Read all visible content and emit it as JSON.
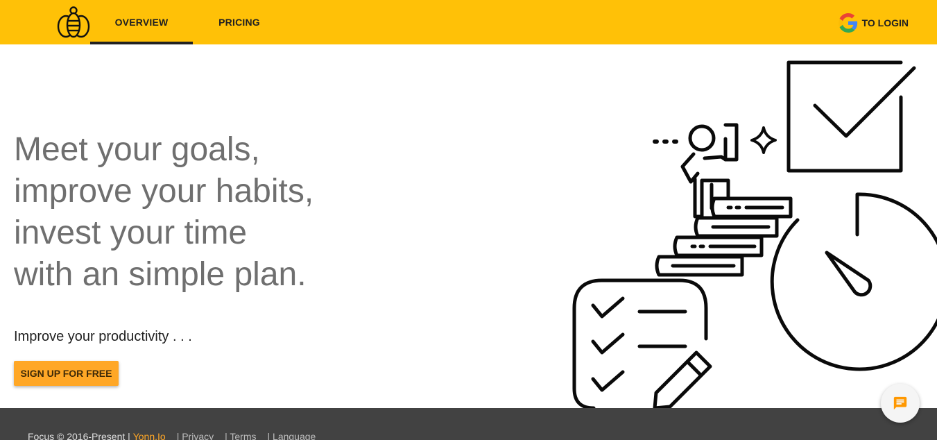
{
  "header": {
    "tabs": [
      {
        "label": "OVERVIEW",
        "active": true
      },
      {
        "label": "PRICING",
        "active": false
      }
    ],
    "login_label": "TO LOGIN",
    "login_icon": "google-icon",
    "logo_icon": "bee-icon"
  },
  "hero": {
    "title_lines": [
      "Meet your goals,",
      "improve your habits,",
      "invest your time",
      "with an simple plan."
    ],
    "subtitle": "Improve your productivity . . .",
    "cta_label": "SIGN UP FOR FREE"
  },
  "footer": {
    "copyright": "Focus © 2016-Present |",
    "brand": "Yonn.Io",
    "links": [
      "| Privacy",
      "| Terms",
      "| Language"
    ]
  },
  "chat": {
    "icon": "chat-icon"
  },
  "colors": {
    "header_bg": "#ffc107",
    "cta_bg": "#ffa726",
    "footer_bg": "#424242",
    "title_text": "#6f6f6f"
  }
}
